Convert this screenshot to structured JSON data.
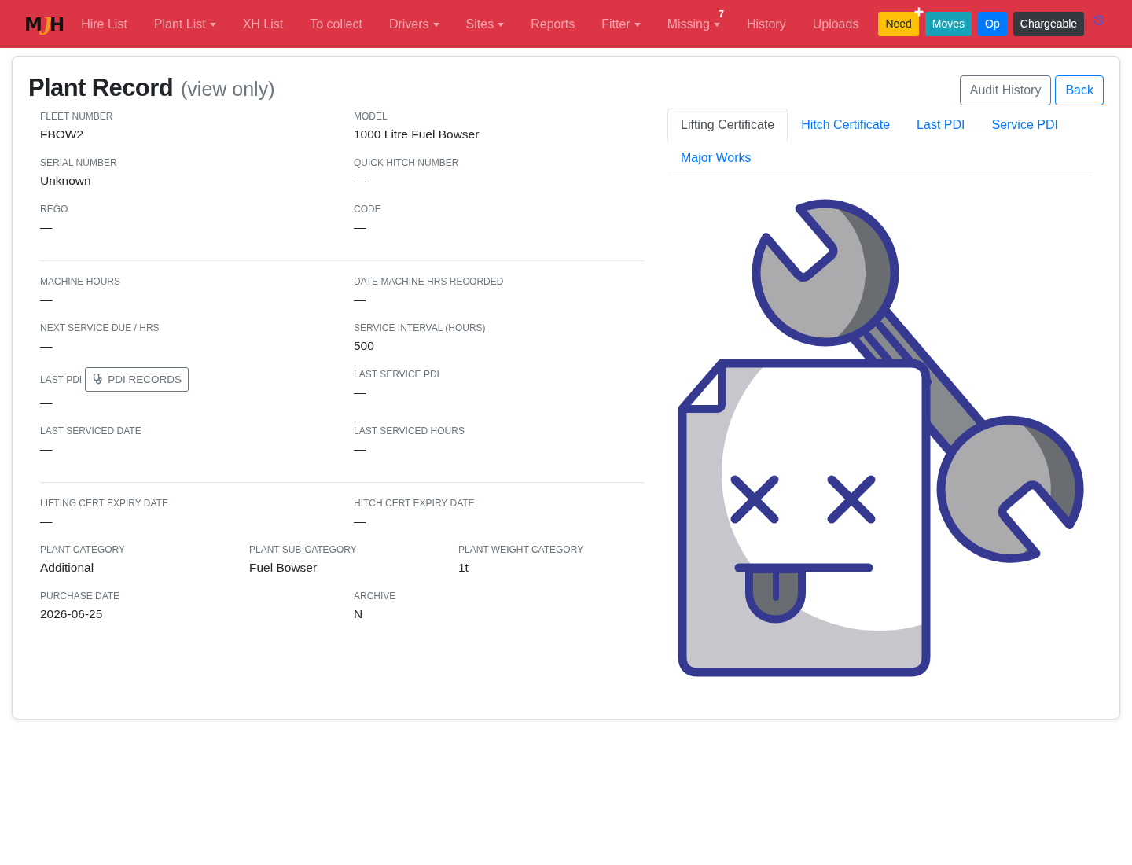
{
  "navbar": {
    "logo": "MJH",
    "links": [
      {
        "label": "Hire List",
        "dropdown": false
      },
      {
        "label": "Plant List",
        "dropdown": true
      },
      {
        "label": "XH List",
        "dropdown": false
      },
      {
        "label": "To collect",
        "dropdown": false
      },
      {
        "label": "Drivers",
        "dropdown": true
      },
      {
        "label": "Sites",
        "dropdown": true
      },
      {
        "label": "Reports",
        "dropdown": false
      },
      {
        "label": "Fitter",
        "dropdown": true
      },
      {
        "label": "Missing",
        "dropdown": true,
        "badge": "7"
      },
      {
        "label": "History",
        "dropdown": false
      },
      {
        "label": "Uploads",
        "dropdown": false
      }
    ],
    "buttons": [
      {
        "label": "Need",
        "color": "#ffc107",
        "plus_marker": true
      },
      {
        "label": "Moves",
        "color": "#17a2b8",
        "plus_marker": false
      },
      {
        "label": "Op",
        "color": "#007bff",
        "plus_marker": false
      },
      {
        "label": "Chargeable",
        "color": "#343a40",
        "plus_marker": false
      }
    ]
  },
  "record": {
    "title": "Plant Record",
    "subtitle": "(view only)",
    "sections": [
      {
        "rows": [
          [
            {
              "label": "FLEET NUMBER",
              "value": "FBOW2"
            },
            {
              "label": "MODEL",
              "value": "1000 Litre Fuel Bowser"
            }
          ],
          [
            {
              "label": "SERIAL NUMBER",
              "value": "Unknown"
            },
            {
              "label": "QUICK HITCH NUMBER",
              "value": "—"
            }
          ],
          [
            {
              "label": "REGO",
              "value": "—"
            },
            {
              "label": "CODE",
              "value": "—"
            }
          ]
        ]
      },
      {
        "rows": [
          [
            {
              "label": "MACHINE HOURS",
              "value": "—"
            },
            {
              "label": "DATE MACHINE HRS RECORDED",
              "value": "—"
            }
          ],
          [
            {
              "label": "NEXT SERVICE DUE / HRS",
              "value": "—"
            },
            {
              "label": "SERVICE INTERVAL (HOURS)",
              "value": "500"
            }
          ],
          [
            {
              "label": "LAST PDI",
              "value": "—",
              "button": "PDI RECORDS"
            },
            {
              "label": "LAST SERVICE PDI",
              "value": "—"
            }
          ],
          [
            {
              "label": "LAST SERVICED DATE",
              "value": "—"
            },
            {
              "label": "LAST SERVICED HOURS",
              "value": "—"
            }
          ]
        ]
      },
      {
        "rows": [
          [
            {
              "label": "LIFTING CERT EXPIRY DATE",
              "value": "—"
            },
            {
              "label": "HITCH CERT EXPIRY DATE",
              "value": "—"
            }
          ],
          [
            {
              "label": "PLANT CATEGORY",
              "value": "Additional"
            },
            {
              "label": "PLANT SUB-CATEGORY",
              "value": "Fuel Bowser"
            },
            {
              "label": "PLANT WEIGHT CATEGORY",
              "value": "1t"
            }
          ],
          [
            {
              "label": "PURCHASE DATE",
              "value": "2026-06-25"
            },
            {
              "label": "ARCHIVE",
              "value": "N"
            }
          ]
        ]
      }
    ]
  },
  "actions": [
    {
      "label": "Audit History",
      "kind": "secondary"
    },
    {
      "label": "Back",
      "kind": "primary"
    }
  ],
  "tabs": [
    {
      "label": "Lifting Certificate",
      "selected": true
    },
    {
      "label": "Hitch Certificate",
      "selected": false
    },
    {
      "label": "Last PDI",
      "selected": false
    },
    {
      "label": "Service PDI",
      "selected": false
    },
    {
      "label": "Major Works",
      "selected": false
    }
  ]
}
